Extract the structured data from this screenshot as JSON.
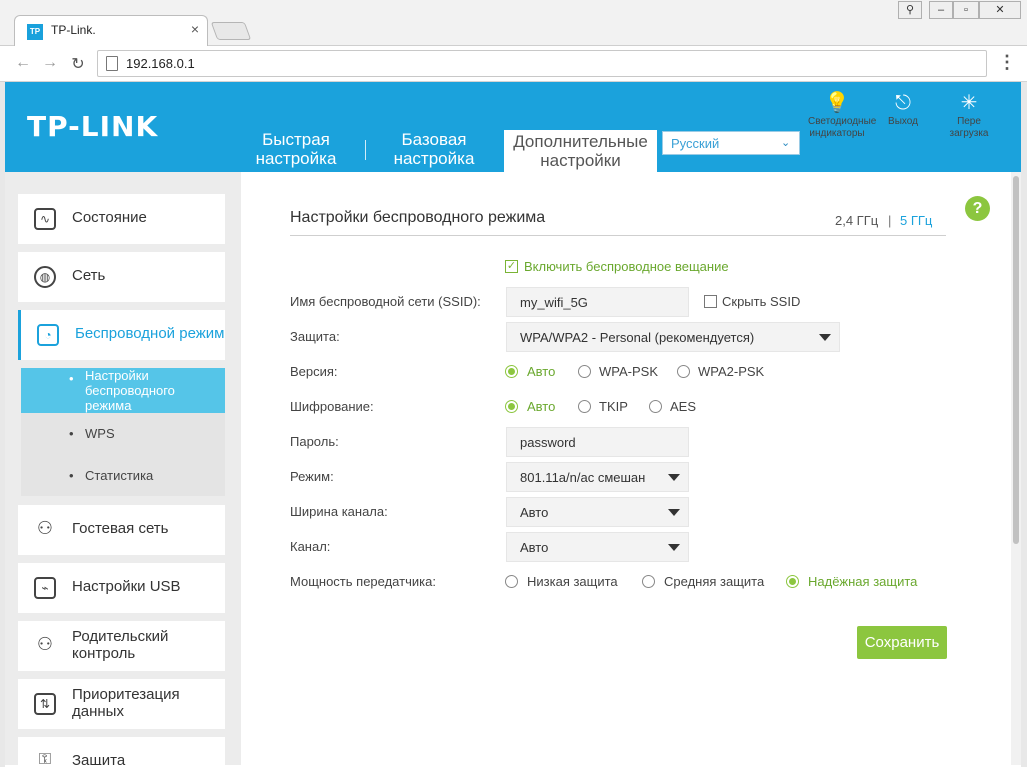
{
  "browser": {
    "tab_favicon": "TP",
    "tab_title": "TP-Link.",
    "tab_close": "×",
    "back": "←",
    "forward": "→",
    "reload": "↻",
    "url": "192.168.0.1",
    "menu": "⋮",
    "win_user": "⚲",
    "win_min": "–",
    "win_max": "▫",
    "win_close": "✕"
  },
  "header": {
    "logo": "TP-LINK",
    "tabs": [
      {
        "label": "Быстрая настройка"
      },
      {
        "label": "Базовая настройка"
      },
      {
        "label": "Дополнительные настройки"
      }
    ],
    "language": "Русский",
    "lang_chevron": "⌄",
    "icons": [
      {
        "symbol": "💡",
        "label": "Светодиодные индикаторы"
      },
      {
        "symbol": "⎋",
        "label": "Выход"
      },
      {
        "symbol": "✳",
        "label": "Пере загрузка"
      }
    ]
  },
  "sidebar": {
    "items": [
      {
        "label": "Состояние",
        "icon": "∿"
      },
      {
        "label": "Сеть",
        "icon": "◍"
      },
      {
        "label": "Беспроводной режим",
        "icon": "◔"
      },
      {
        "label": "Гостевая сеть",
        "icon": "⚇"
      },
      {
        "label": "Настройки USB",
        "icon": "⌁"
      },
      {
        "label": "Родительский контроль",
        "icon": "⚇"
      },
      {
        "label": "Приоритезация данных",
        "icon": "⇅"
      },
      {
        "label": "Защита",
        "icon": "⚿"
      }
    ],
    "subitems": [
      {
        "label": "Настройки беспроводного режима"
      },
      {
        "label": "WPS"
      },
      {
        "label": "Статистика"
      }
    ],
    "bullet": "•"
  },
  "page": {
    "title": "Настройки беспроводного режима",
    "band_24": "2,4 ГГц",
    "band_sep": "|",
    "band_5": "5 ГГц",
    "help": "?",
    "enable_broadcast": "Включить беспроводное вещание",
    "check_mark": "✓",
    "ssid_label": "Имя беспроводной сети (SSID):",
    "ssid_value": "my_wifi_5G",
    "hide_ssid": "Скрыть SSID",
    "security_label": "Защита:",
    "security_value": "WPA/WPA2 - Personal (рекомендуется)",
    "version_label": "Версия:",
    "version_options": [
      "Авто",
      "WPA-PSK",
      "WPA2-PSK"
    ],
    "encryption_label": "Шифрование:",
    "encryption_options": [
      "Авто",
      "TKIP",
      "AES"
    ],
    "password_label": "Пароль:",
    "password_value": "password",
    "mode_label": "Режим:",
    "mode_value": "801.11a/n/ac смешан",
    "width_label": "Ширина канала:",
    "width_value": "Авто",
    "channel_label": "Канал:",
    "channel_value": "Авто",
    "power_label": "Мощность передатчика:",
    "power_options": [
      "Низкая защита",
      "Средняя защита",
      "Надёжная защита"
    ],
    "save": "Сохранить"
  },
  "colors": {
    "brand": "#1ba2dc",
    "accent_green": "#8cc63f"
  }
}
